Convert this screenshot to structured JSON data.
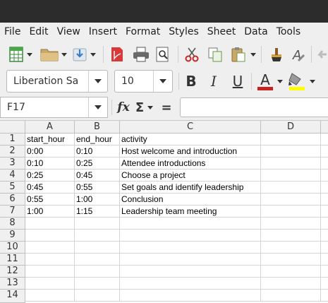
{
  "menu": [
    "File",
    "Edit",
    "View",
    "Insert",
    "Format",
    "Styles",
    "Sheet",
    "Data",
    "Tools"
  ],
  "toolbar": {
    "font_name": "Liberation Sa",
    "font_size": "10",
    "bold": "B",
    "italic": "I",
    "underline": "U",
    "font_color": "A",
    "font_color_hex": "#c9211e",
    "highlight_hex": "#ffff00"
  },
  "formula_bar": {
    "cell_ref": "F17",
    "fx": "fx",
    "sigma": "Σ",
    "equals": "=",
    "formula": ""
  },
  "columns": [
    "A",
    "B",
    "C",
    "D"
  ],
  "rows": [
    "1",
    "2",
    "3",
    "4",
    "5",
    "6",
    "7",
    "8",
    "9",
    "10",
    "11",
    "12",
    "13",
    "14"
  ],
  "cells": [
    [
      "start_hour",
      "end_hour",
      "activity"
    ],
    [
      "0:00",
      "0:10",
      "Host welcome and introduction"
    ],
    [
      "0:10",
      "0:25",
      "Attendee introductions"
    ],
    [
      "0:25",
      "0:45",
      "Choose a project"
    ],
    [
      "0:45",
      "0:55",
      "Set goals and identify leadership"
    ],
    [
      "0:55",
      "1:00",
      "Conclusion"
    ],
    [
      "1:00",
      "1:15",
      "Leadership team meeting"
    ]
  ]
}
